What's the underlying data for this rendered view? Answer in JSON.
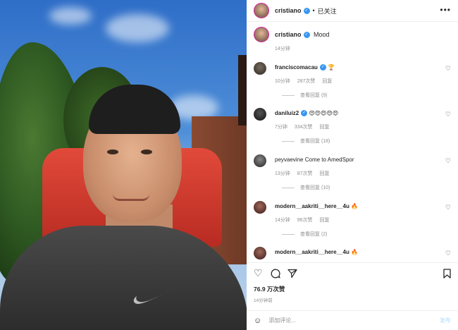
{
  "header": {
    "username": "cristiano",
    "follow_status": "已关注",
    "more_icon": "more-dots-icon"
  },
  "caption": {
    "username": "cristiano",
    "text": "Mood",
    "time": "14分钟"
  },
  "comments": [
    {
      "username": "franciscomacau",
      "text": "🏆",
      "verified": true,
      "time": "10分钟",
      "likes": "287次赞",
      "reply": "回复",
      "view_replies": "查看回复 (9)"
    },
    {
      "username": "daniluiz2",
      "text": "😍😍😍😍😍",
      "verified": true,
      "time": "7分钟",
      "likes": "334次赞",
      "reply": "回复",
      "view_replies": "查看回复 (18)"
    },
    {
      "username": "peyvaevine",
      "text": "Come to AmedSpor",
      "verified": false,
      "time": "13分钟",
      "likes": "87次赞",
      "reply": "回复",
      "view_replies": "查看回复 (10)"
    },
    {
      "username": "modern__aakriti__here__4u",
      "text": "🔥",
      "verified": false,
      "time": "14分钟",
      "likes": "96次赞",
      "reply": "回复",
      "view_replies": "查看回复 (2)"
    },
    {
      "username": "modern__aakriti__here__4u",
      "text": "🔥",
      "verified": false
    }
  ],
  "actions": {
    "like_icon": "heart-icon",
    "comment_icon": "comment-icon",
    "share_icon": "share-icon",
    "save_icon": "bookmark-icon"
  },
  "likes_count": "76.9 万次赞",
  "posted_time": "14分钟前",
  "add_comment": {
    "placeholder": "添加评论...",
    "post_label": "发布",
    "emoji_icon": "smiley-icon"
  },
  "colors": {
    "verified_blue": "#3897f0",
    "post_disabled": "#b3dbff",
    "muted_text": "#8e8e8e"
  }
}
